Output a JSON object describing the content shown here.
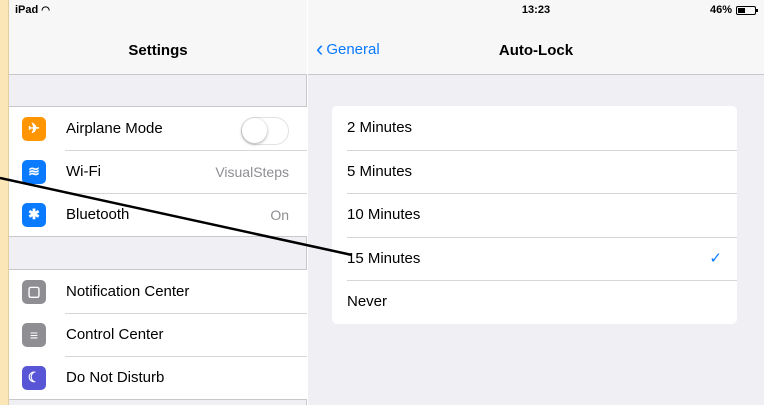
{
  "status_bar": {
    "device": "iPad",
    "time": "13:23",
    "battery": "46%",
    "battery_level": 0.46
  },
  "left": {
    "title": "Settings",
    "group1": [
      {
        "name": "row-airplane-mode",
        "label": "Airplane Mode",
        "icon": "airplane-icon",
        "icon_color": "#FF9500",
        "glyph": "✈",
        "control": "toggle",
        "on": false
      },
      {
        "name": "row-wifi",
        "label": "Wi-Fi",
        "icon": "wifi-icon",
        "icon_color": "#0A7AFF",
        "glyph": "≋",
        "value": "VisualSteps"
      },
      {
        "name": "row-bluetooth",
        "label": "Bluetooth",
        "icon": "bluetooth-icon",
        "icon_color": "#0A7AFF",
        "glyph": "✱",
        "value": "On"
      }
    ],
    "group2": [
      {
        "name": "row-notification-center",
        "label": "Notification Center",
        "icon": "notification-center-icon",
        "icon_color": "#8E8E93",
        "glyph": "▢"
      },
      {
        "name": "row-control-center",
        "label": "Control Center",
        "icon": "control-center-icon",
        "icon_color": "#8E8E93",
        "glyph": "≡"
      },
      {
        "name": "row-do-not-disturb",
        "label": "Do Not Disturb",
        "icon": "do-not-disturb-icon",
        "icon_color": "#5856D6",
        "glyph": "☾"
      }
    ]
  },
  "right": {
    "back_label": "General",
    "title": "Auto-Lock",
    "options": [
      {
        "label": "2 Minutes",
        "selected": false
      },
      {
        "label": "5 Minutes",
        "selected": false
      },
      {
        "label": "10 Minutes",
        "selected": false
      },
      {
        "label": "15 Minutes",
        "selected": true
      },
      {
        "label": "Never",
        "selected": false
      }
    ]
  },
  "colors": {
    "accent": "#0A7AFF",
    "background": "#EFEFF4",
    "annotation_strip": "#FBE6B8"
  },
  "checkmark": "✓"
}
